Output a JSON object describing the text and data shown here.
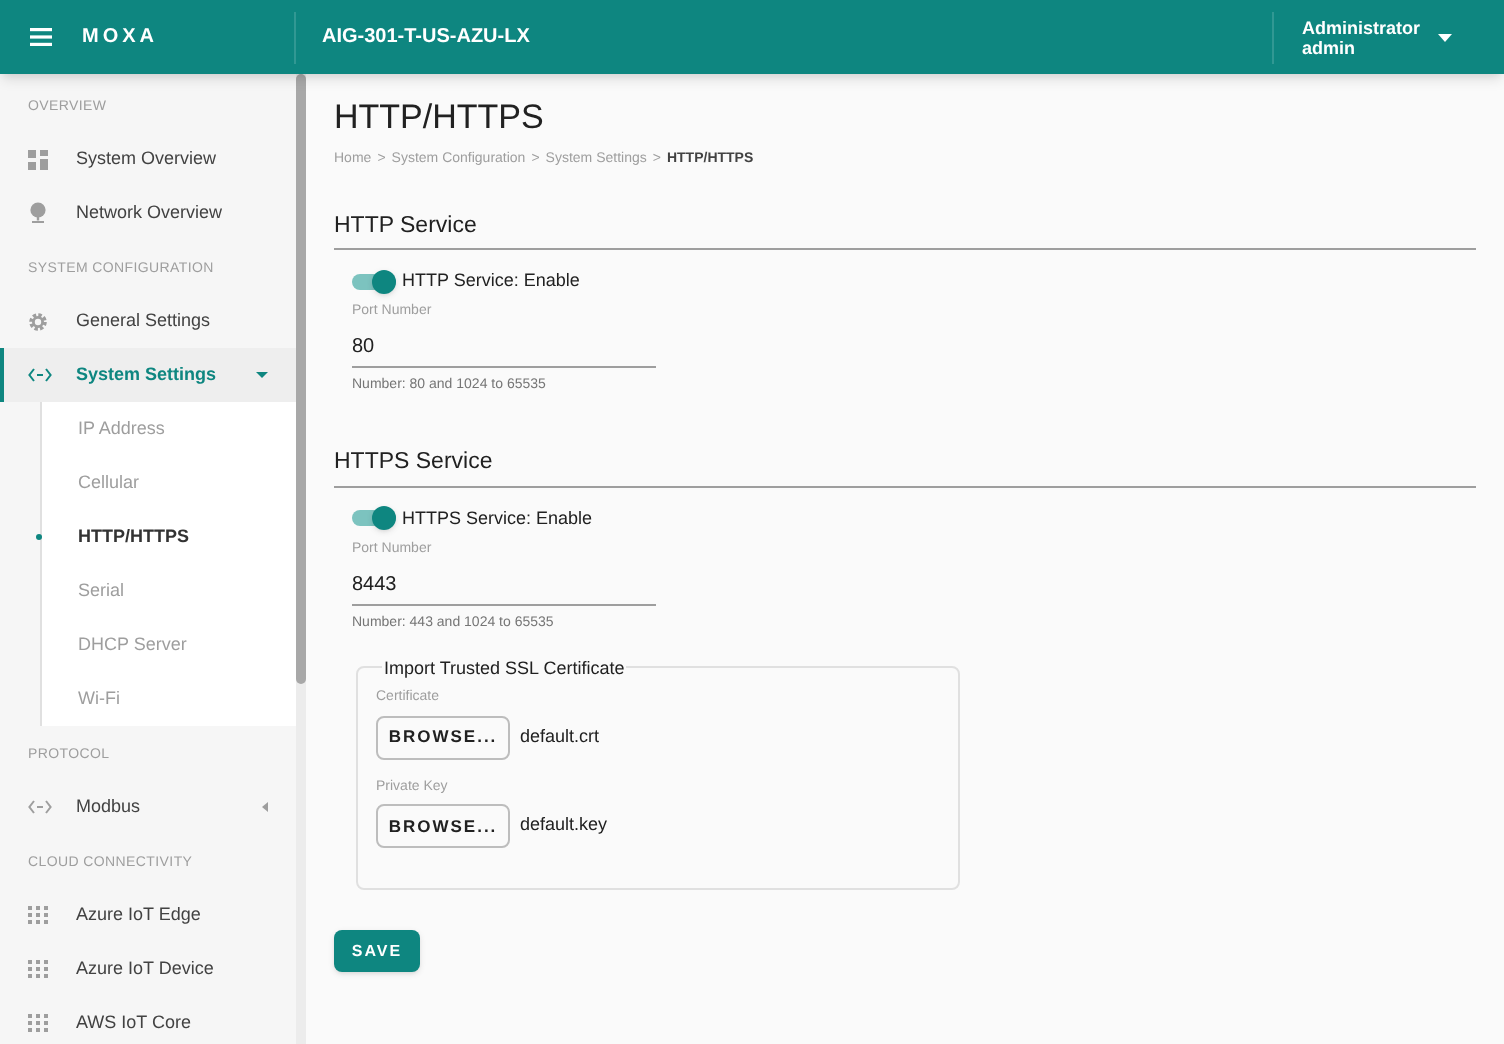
{
  "header": {
    "brand": "MOXA",
    "device": "AIG-301-T-US-AZU-LX",
    "user": {
      "role": "Administrator",
      "name": "admin"
    }
  },
  "sidebar": {
    "sections": [
      {
        "heading": "OVERVIEW",
        "items": [
          {
            "kind": "link",
            "label": "System Overview",
            "selected": false
          },
          {
            "kind": "link",
            "label": "Network Overview",
            "selected": false
          }
        ]
      },
      {
        "heading": "SYSTEM CONFIGURATION",
        "items": [
          {
            "kind": "link",
            "label": "General Settings",
            "selected": false
          },
          {
            "kind": "group",
            "label": "System Settings",
            "selected": true,
            "expanded": true,
            "children": [
              {
                "label": "IP Address",
                "selected": false
              },
              {
                "label": "Cellular",
                "selected": false
              },
              {
                "label": "HTTP/HTTPS",
                "selected": true
              },
              {
                "label": "Serial",
                "selected": false
              },
              {
                "label": "DHCP Server",
                "selected": false
              },
              {
                "label": "Wi-Fi",
                "selected": false
              }
            ]
          }
        ]
      },
      {
        "heading": "PROTOCOL",
        "items": [
          {
            "kind": "group",
            "label": "Modbus",
            "selected": false,
            "expanded": false
          }
        ]
      },
      {
        "heading": "CLOUD CONNECTIVITY",
        "items": [
          {
            "kind": "link",
            "label": "Azure IoT Edge",
            "selected": false
          },
          {
            "kind": "link",
            "label": "Azure IoT Device",
            "selected": false
          },
          {
            "kind": "link",
            "label": "AWS IoT Core",
            "selected": false
          }
        ]
      }
    ]
  },
  "page": {
    "title": "HTTP/HTTPS",
    "breadcrumb": [
      {
        "label": "Home",
        "separator": ">"
      },
      {
        "label": "System Configuration",
        "separator": ">"
      },
      {
        "label": "System Settings",
        "separator": ">"
      },
      {
        "label": "HTTP/HTTPS"
      }
    ],
    "sections": [
      {
        "title": "HTTP Service",
        "toggle": {
          "label": "HTTP Service: Enable",
          "on": true
        },
        "port": {
          "label": "Port Number",
          "value": "80",
          "hint": "Number: 80 and 1024 to 65535"
        }
      },
      {
        "title": "HTTPS Service",
        "toggle": {
          "label": "HTTPS Service: Enable",
          "on": true
        },
        "port": {
          "label": "Port Number",
          "value": "8443",
          "hint": "Number: 443 and 1024 to 65535"
        },
        "certificate_group": {
          "legend": "Import Trusted SSL Certificate",
          "files": [
            {
              "label": "Certificate",
              "button": "BROWSE...",
              "file": "default.crt"
            },
            {
              "label": "Private Key",
              "button": "BROWSE...",
              "file": "default.key"
            }
          ]
        }
      }
    ],
    "save_button": "SAVE"
  }
}
